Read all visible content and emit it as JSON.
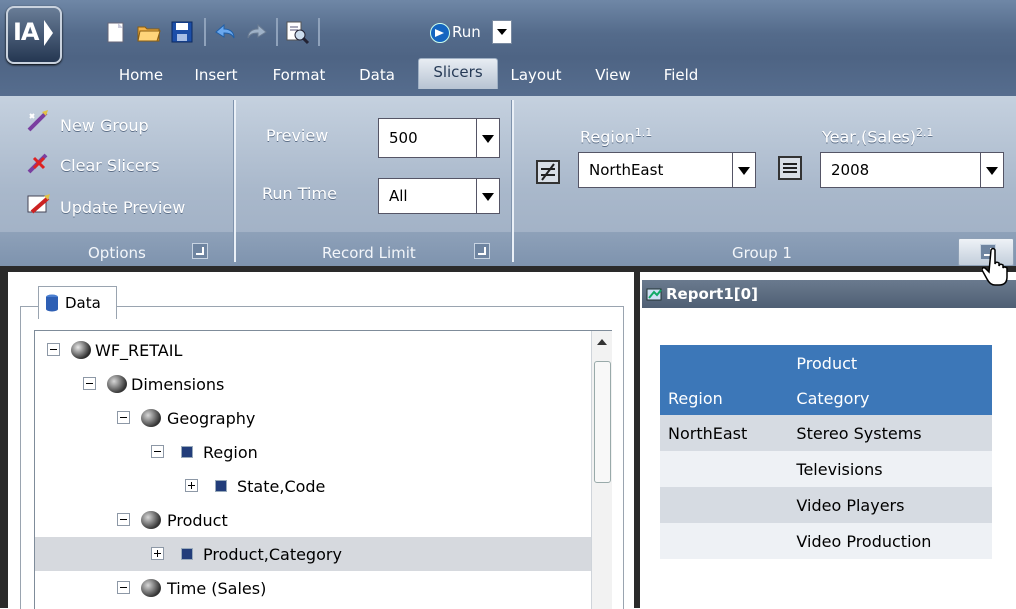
{
  "app": {
    "logo_text": "IA"
  },
  "toolbar": {
    "run_label": "Run"
  },
  "menu_tabs": [
    {
      "label": "Home"
    },
    {
      "label": "Insert"
    },
    {
      "label": "Format"
    },
    {
      "label": "Data"
    },
    {
      "label": "Slicers",
      "active": true
    },
    {
      "label": "Layout"
    },
    {
      "label": "View"
    },
    {
      "label": "Field"
    }
  ],
  "ribbon": {
    "options": {
      "new_group": "New Group",
      "clear_slicers": "Clear Slicers",
      "update_preview": "Update Preview",
      "group_label": "Options"
    },
    "record_limit": {
      "preview_label": "Preview",
      "preview_value": "500",
      "runtime_label": "Run Time",
      "runtime_value": "All",
      "group_label": "Record Limit"
    },
    "group1": {
      "region_label": "Region",
      "region_sup": "1.1",
      "region_value": "NorthEast",
      "year_label": "Year,(Sales)",
      "year_sup": "2.1",
      "year_value": "2008",
      "group_label": "Group 1"
    }
  },
  "data_panel": {
    "tab_label": "Data",
    "tree": [
      {
        "label": "WF_RETAIL"
      },
      {
        "label": "Dimensions"
      },
      {
        "label": "Geography"
      },
      {
        "label": "Region"
      },
      {
        "label": "State,Code"
      },
      {
        "label": "Product"
      },
      {
        "label": "Product,Category",
        "selected": true
      },
      {
        "label": "Time (Sales)"
      }
    ]
  },
  "report": {
    "title": "Report1[0]",
    "headers": {
      "region": "Region",
      "category_line1": "Product",
      "category_line2": "Category"
    },
    "rows": [
      {
        "region": "NorthEast",
        "category": "Stereo Systems"
      },
      {
        "region": "",
        "category": "Televisions"
      },
      {
        "region": "",
        "category": "Video Players"
      },
      {
        "region": "",
        "category": "Video Production"
      }
    ]
  }
}
